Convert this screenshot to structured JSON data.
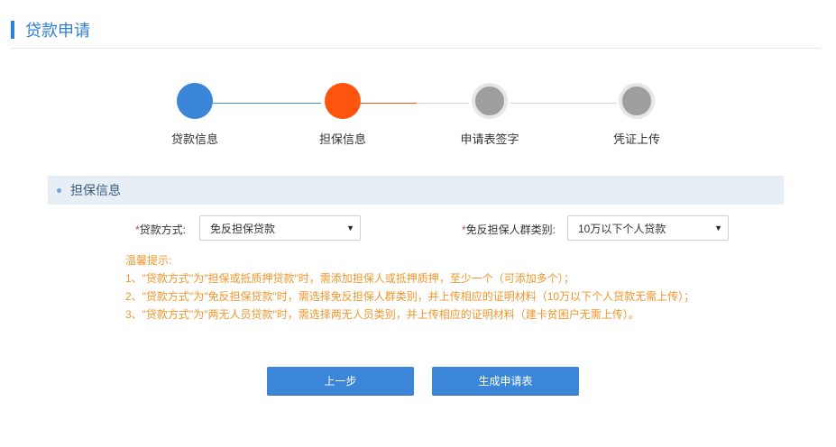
{
  "header": {
    "title": "贷款申请"
  },
  "steps": [
    {
      "label": "贷款信息",
      "state": "done",
      "color": "#3a85d8"
    },
    {
      "label": "担保信息",
      "state": "active",
      "color": "#fd5410"
    },
    {
      "label": "申请表签字",
      "state": "pending",
      "color": "#9e9e9e"
    },
    {
      "label": "凭证上传",
      "state": "pending",
      "color": "#9e9e9e"
    }
  ],
  "section": {
    "title": "担保信息"
  },
  "form": {
    "loan_method": {
      "label": "贷款方式:",
      "value": "免反担保贷款"
    },
    "exempt_group": {
      "label": "免反担保人群类别:",
      "value": "10万以下个人贷款"
    },
    "required_mark": "*"
  },
  "tips": {
    "title": "温馨提示:",
    "items": [
      "1、\"贷款方式\"为\"担保或抵质押贷款\"时，需添加担保人或抵押质押，至少一个（可添加多个）；",
      "2、\"贷款方式\"为\"免反担保贷款\"时，需选择免反担保人群类别，并上传相应的证明材料（10万以下个人贷款无需上传）；",
      "3、\"贷款方式\"为\"两无人员贷款\"时，需选择两无人员类别，并上传相应的证明材料（建卡贫困户无需上传）。"
    ]
  },
  "buttons": {
    "prev": "上一步",
    "generate": "生成申请表"
  },
  "colors": {
    "accent": "#2f7fd4",
    "active_step": "#fd5410",
    "tip": "#f0962d",
    "button": "#3b86d9"
  }
}
